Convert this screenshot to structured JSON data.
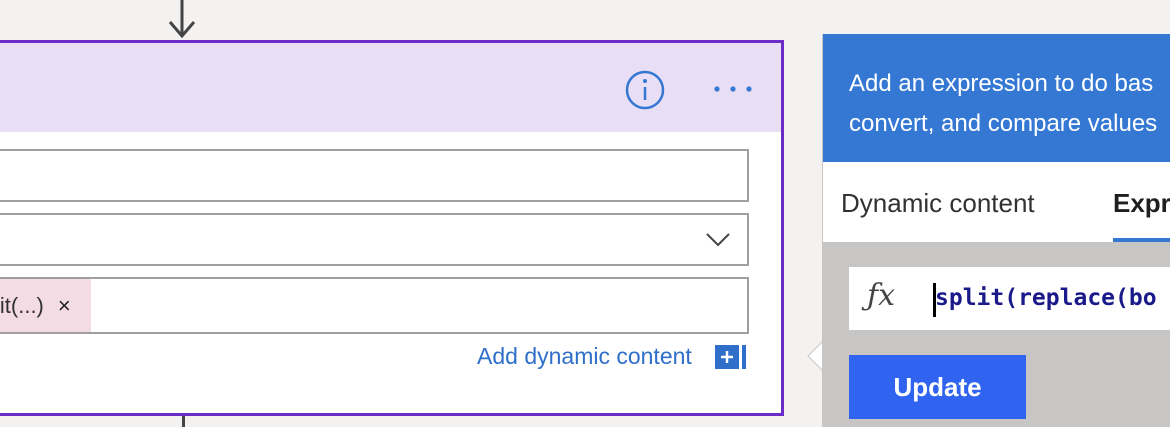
{
  "card": {
    "token_label": "lit(...)",
    "token_remove": "×",
    "add_dynamic_content": "Add dynamic content"
  },
  "panel": {
    "banner_line1": "Add an expression to do bas",
    "banner_line2": "convert, and compare values",
    "tabs": [
      {
        "label": "Dynamic content",
        "active": false
      },
      {
        "label": "Expre",
        "active": true
      }
    ],
    "expression_value": "split(replace(bo",
    "update_label": "Update"
  },
  "colors": {
    "card_border": "#6b2bc7",
    "card_header": "#e8def6",
    "banner": "#3478d4",
    "update_button": "#2f63f0",
    "token_bg": "#f4dce4"
  },
  "icons": [
    "info-icon",
    "more-icon",
    "chevron-down-icon",
    "add-icon",
    "fx-icon",
    "arrow-down-icon"
  ]
}
